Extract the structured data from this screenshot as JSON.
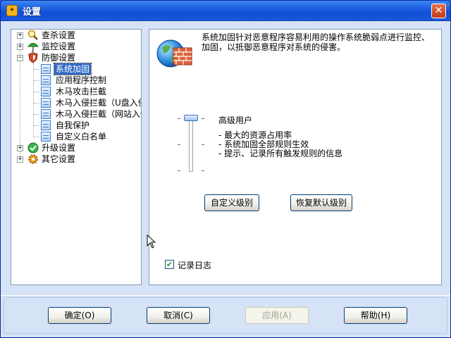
{
  "window": {
    "title": "设置",
    "close_symbol": "✕"
  },
  "tree": {
    "items": [
      {
        "label": "查杀设置",
        "icon": "magnifier-icon"
      },
      {
        "label": "监控设置",
        "icon": "umbrella-icon"
      },
      {
        "label": "防御设置",
        "icon": "shield-icon"
      },
      {
        "label": "系统加固",
        "icon": "document-icon"
      },
      {
        "label": "应用程序控制",
        "icon": "document-icon"
      },
      {
        "label": "木马攻击拦截",
        "icon": "document-icon"
      },
      {
        "label": "木马入侵拦截（U盘入侵",
        "icon": "document-icon"
      },
      {
        "label": "木马入侵拦截（网站入侵",
        "icon": "document-icon"
      },
      {
        "label": "自我保护",
        "icon": "document-icon"
      },
      {
        "label": "自定义白名单",
        "icon": "document-icon"
      },
      {
        "label": "升级设置",
        "icon": "upgrade-icon"
      },
      {
        "label": "其它设置",
        "icon": "gear-icon"
      }
    ],
    "selected": "系统加固",
    "expander_plus": "+",
    "expander_minus": "−"
  },
  "detail": {
    "description": "系统加固针对恶意程序容易利用的操作系统脆弱点进行监控、加固，以抵御恶意程序对系统的侵害。",
    "level_name": "高级用户",
    "level_details": [
      "- 最大的资源占用率",
      "- 系统加固全部规则生效",
      "- 提示、记录所有触发规则的信息"
    ],
    "slider_level_fraction": 1.0,
    "custom_level_button": "自定义级别",
    "restore_default_button": "恢复默认级别",
    "log_checkbox": {
      "label": "记录日志",
      "checked": true,
      "mark": "✔"
    }
  },
  "footer": {
    "ok_button": "确定(O)",
    "cancel_button": "取消(C)",
    "apply_button": "应用(A)",
    "help_button": "帮助(H)"
  },
  "colors": {
    "titlebar": "#1c5fe0",
    "selection": "#316ac5",
    "dialog_bg": "#d6e2f5"
  }
}
